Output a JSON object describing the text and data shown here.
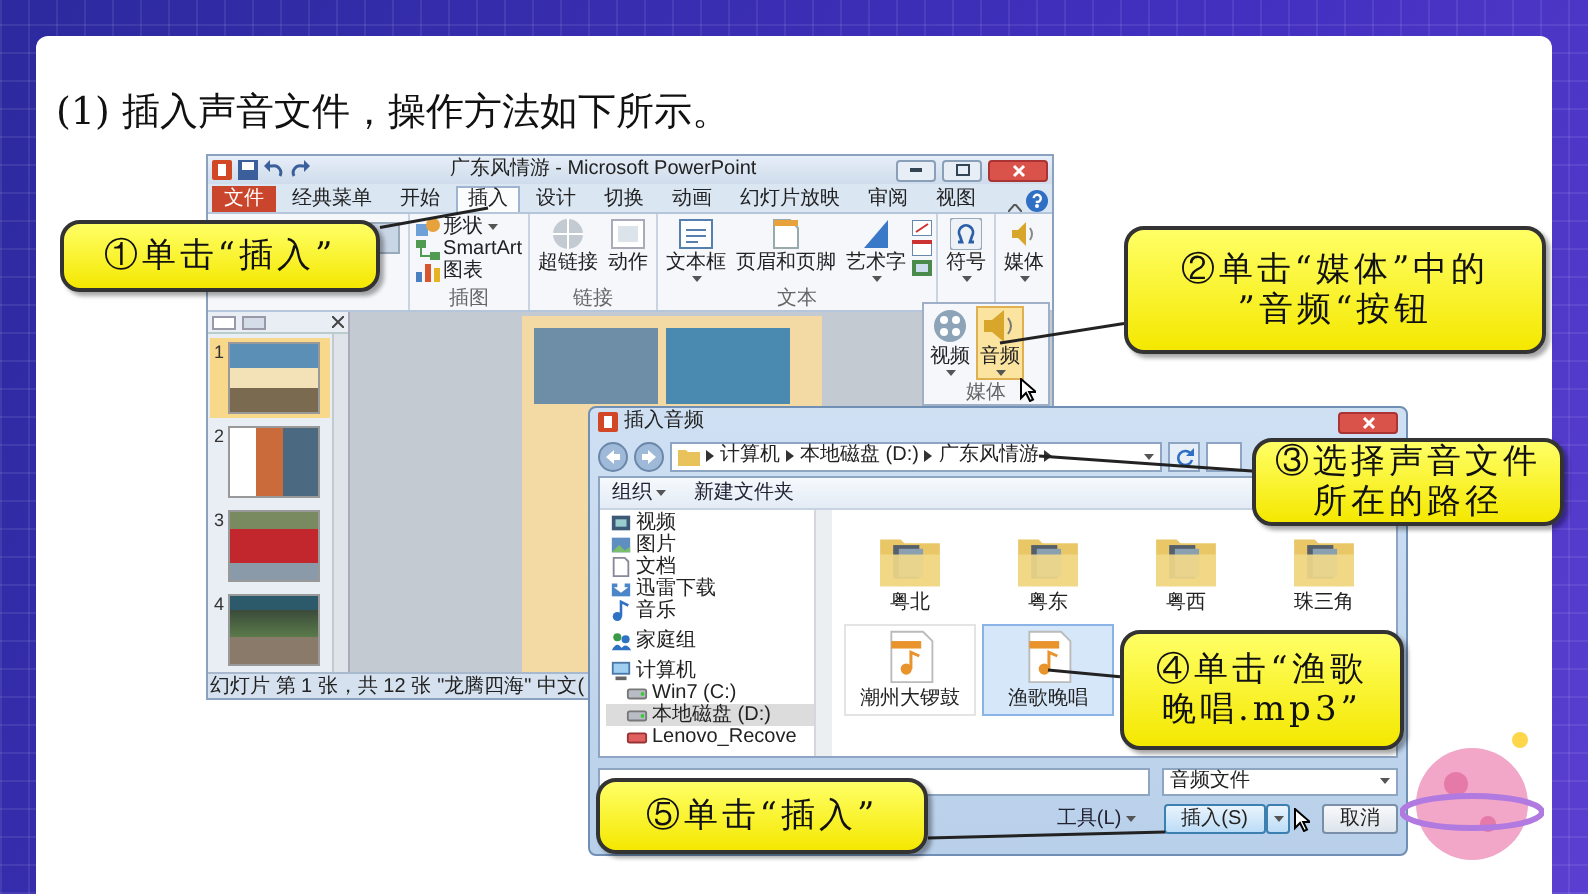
{
  "heading": "(1) 插入声音文件，操作方法如下所示。",
  "ppt_window": {
    "title": "广东风情游 - Microsoft PowerPoint",
    "tabs": [
      {
        "label": "文件",
        "kind": "file",
        "selected": false
      },
      {
        "label": "经典菜单",
        "kind": "tab",
        "selected": false
      },
      {
        "label": "开始",
        "kind": "tab",
        "selected": false
      },
      {
        "label": "插入",
        "kind": "tab",
        "selected": true
      },
      {
        "label": "设计",
        "kind": "tab",
        "selected": false
      },
      {
        "label": "切换",
        "kind": "tab",
        "selected": false
      },
      {
        "label": "动画",
        "kind": "tab",
        "selected": false
      },
      {
        "label": "幻灯片放映",
        "kind": "tab",
        "selected": false
      },
      {
        "label": "审阅",
        "kind": "tab",
        "selected": false
      },
      {
        "label": "视图",
        "kind": "tab",
        "selected": false
      }
    ],
    "ribbon_groups": [
      {
        "label": "插图",
        "kind": "small",
        "items": [
          {
            "label": "形状",
            "kind": "shapes",
            "menu": true
          },
          {
            "label": "SmartArt",
            "kind": "smartart",
            "menu": false
          },
          {
            "label": "图表",
            "kind": "chart",
            "menu": false
          }
        ]
      },
      {
        "label": "链接",
        "kind": "large",
        "items": [
          {
            "label": "超链接",
            "kind": "hyperlink",
            "menu": false
          },
          {
            "label": "动作",
            "kind": "action",
            "menu": false
          }
        ]
      },
      {
        "label": "文本",
        "kind": "large",
        "items": [
          {
            "label": "文本框",
            "kind": "textbox",
            "menu": true
          },
          {
            "label": "页眉和页脚",
            "kind": "header",
            "menu": false
          },
          {
            "label": "艺术字",
            "kind": "wordart",
            "menu": true
          }
        ]
      },
      {
        "kind": "large",
        "items": [
          {
            "label": "符号",
            "kind": "symbol",
            "menu": true
          }
        ]
      },
      {
        "kind": "large",
        "items": [
          {
            "label": "媒体",
            "kind": "media",
            "menu": true
          }
        ]
      }
    ],
    "media_menu": {
      "label": "媒体",
      "items": [
        {
          "label": "视频",
          "kind": "video",
          "menu": true,
          "selected": false
        },
        {
          "label": "音频",
          "kind": "audio",
          "menu": true,
          "selected": true
        }
      ]
    },
    "slides": [
      {
        "number": "1",
        "selected": true
      },
      {
        "number": "2",
        "selected": false
      },
      {
        "number": "3",
        "selected": false
      },
      {
        "number": "4",
        "selected": false
      }
    ],
    "status_bar": [
      "幻灯片 第 1 张，共 12 张",
      "\"龙腾四海\"",
      "中文("
    ]
  },
  "dialog": {
    "title": "插入音频",
    "path": [
      "计算机",
      "本地磁盘 (D:)",
      "广东风情游"
    ],
    "toolbar": [
      {
        "label": "组织",
        "menu": true
      },
      {
        "label": "新建文件夹",
        "menu": false
      }
    ],
    "nav": [
      {
        "label": "视频",
        "kind": "video",
        "selected": false
      },
      {
        "label": "图片",
        "kind": "picture",
        "selected": false
      },
      {
        "label": "文档",
        "kind": "document",
        "selected": false
      },
      {
        "label": "迅雷下载",
        "kind": "download",
        "selected": false
      },
      {
        "label": "音乐",
        "kind": "music",
        "selected": false
      },
      {
        "label": "家庭组",
        "kind": "homegroup",
        "selected": false
      },
      {
        "label": "计算机",
        "kind": "computer",
        "selected": false,
        "children": [
          {
            "label": "Win7 (C:)",
            "kind": "drive",
            "selected": false
          },
          {
            "label": "本地磁盘 (D:)",
            "kind": "drive",
            "selected": true
          },
          {
            "label": "Lenovo_Recove",
            "kind": "recovery",
            "selected": false
          }
        ]
      }
    ],
    "files": [
      {
        "name": "粤北",
        "kind": "folder",
        "selected": false
      },
      {
        "name": "粤东",
        "kind": "folder",
        "selected": false
      },
      {
        "name": "粤西",
        "kind": "folder",
        "selected": false
      },
      {
        "name": "珠三角",
        "kind": "folder",
        "selected": false
      },
      {
        "name": "潮州大锣鼓",
        "kind": "audio",
        "selected": false
      },
      {
        "name": "渔歌晚唱",
        "kind": "audio",
        "selected": true
      }
    ],
    "file_type": "音频文件",
    "tools": "工具(L)",
    "insert": "插入(S)",
    "cancel": "取消"
  },
  "callouts": [
    {
      "lines": [
        "①单击“插入”"
      ]
    },
    {
      "lines": [
        "②单击“媒体”中的",
        "”音频“按钮"
      ]
    },
    {
      "lines": [
        "③选择声音文件",
        "所在的路径"
      ]
    },
    {
      "lines": [
        "④单击“渔歌",
        "晚唱.mp3”"
      ]
    },
    {
      "lines": [
        "⑤单击“插入”"
      ]
    }
  ]
}
